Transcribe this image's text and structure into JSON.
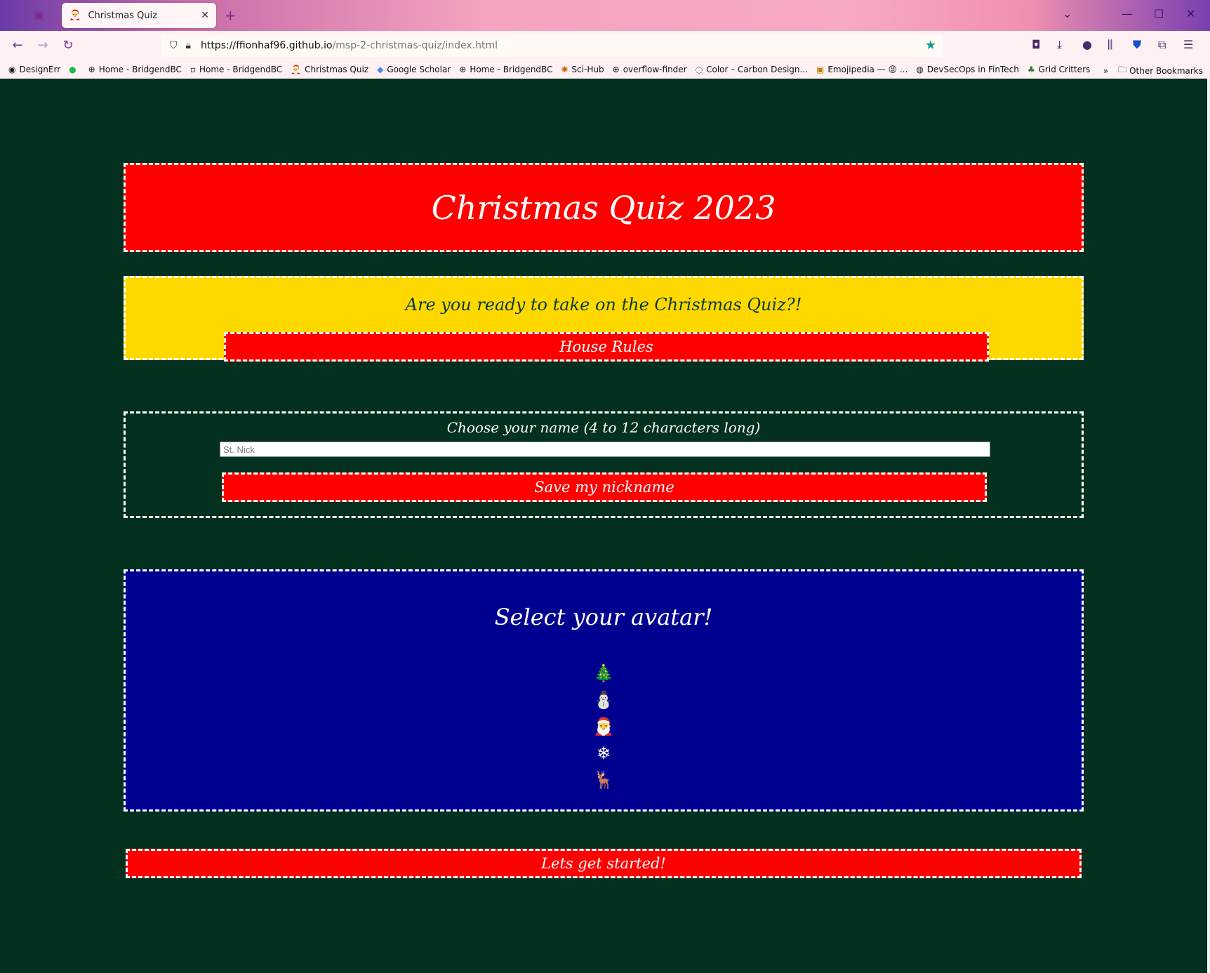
{
  "browser": {
    "tab": {
      "icon": "santa-emoji",
      "title": "Christmas Quiz"
    },
    "url": {
      "host": "https://ffionhaf96.github.io",
      "path": "/msp-2-christmas-quiz/index.html"
    },
    "bookmarks": [
      {
        "icon": "github-icon",
        "label": "DesignErr"
      },
      {
        "icon": "spotify-icon",
        "label": ""
      },
      {
        "icon": "globe-icon",
        "label": "Home - BridgendBC"
      },
      {
        "icon": "page-icon",
        "label": "Home - BridgendBC"
      },
      {
        "icon": "santa-icon",
        "label": "Christmas Quiz"
      },
      {
        "icon": "scholar-icon",
        "label": "Google Scholar"
      },
      {
        "icon": "globe-icon",
        "label": "Home - BridgendBC"
      },
      {
        "icon": "scihub-icon",
        "label": "Sci-Hub"
      },
      {
        "icon": "globe-icon",
        "label": "overflow-finder"
      },
      {
        "icon": "carbon-icon",
        "label": "Color – Carbon Design..."
      },
      {
        "icon": "emojipedia-icon",
        "label": "Emojipedia — 😜 ..."
      },
      {
        "icon": "devsecops-icon",
        "label": "DevSecOps in FinTech"
      },
      {
        "icon": "gridcritters-icon",
        "label": "Grid Critters"
      }
    ],
    "other_bookmarks": "Other Bookmarks"
  },
  "page": {
    "title": "Christmas Quiz 2023",
    "ready_text": "Are you ready to take on the Christmas Quiz?!",
    "rules_button": "House Rules",
    "name_label": "Choose your name (4 to 12 characters long)",
    "name_placeholder": "St. Nick",
    "save_button": "Save my nickname",
    "avatar_title": "Select your avatar!",
    "avatars": [
      {
        "name": "christmas-tree",
        "glyph": "🎄"
      },
      {
        "name": "snowman",
        "glyph": "⛄"
      },
      {
        "name": "santa",
        "glyph": "🎅"
      },
      {
        "name": "snowflake",
        "glyph": "❄"
      },
      {
        "name": "reindeer",
        "glyph": "🦌"
      }
    ],
    "start_button": "Lets get started!"
  },
  "colors": {
    "background": "#03301f",
    "red": "#ff0000",
    "yellow": "#ffd800",
    "navy": "#000090",
    "border": "#ffffff"
  }
}
